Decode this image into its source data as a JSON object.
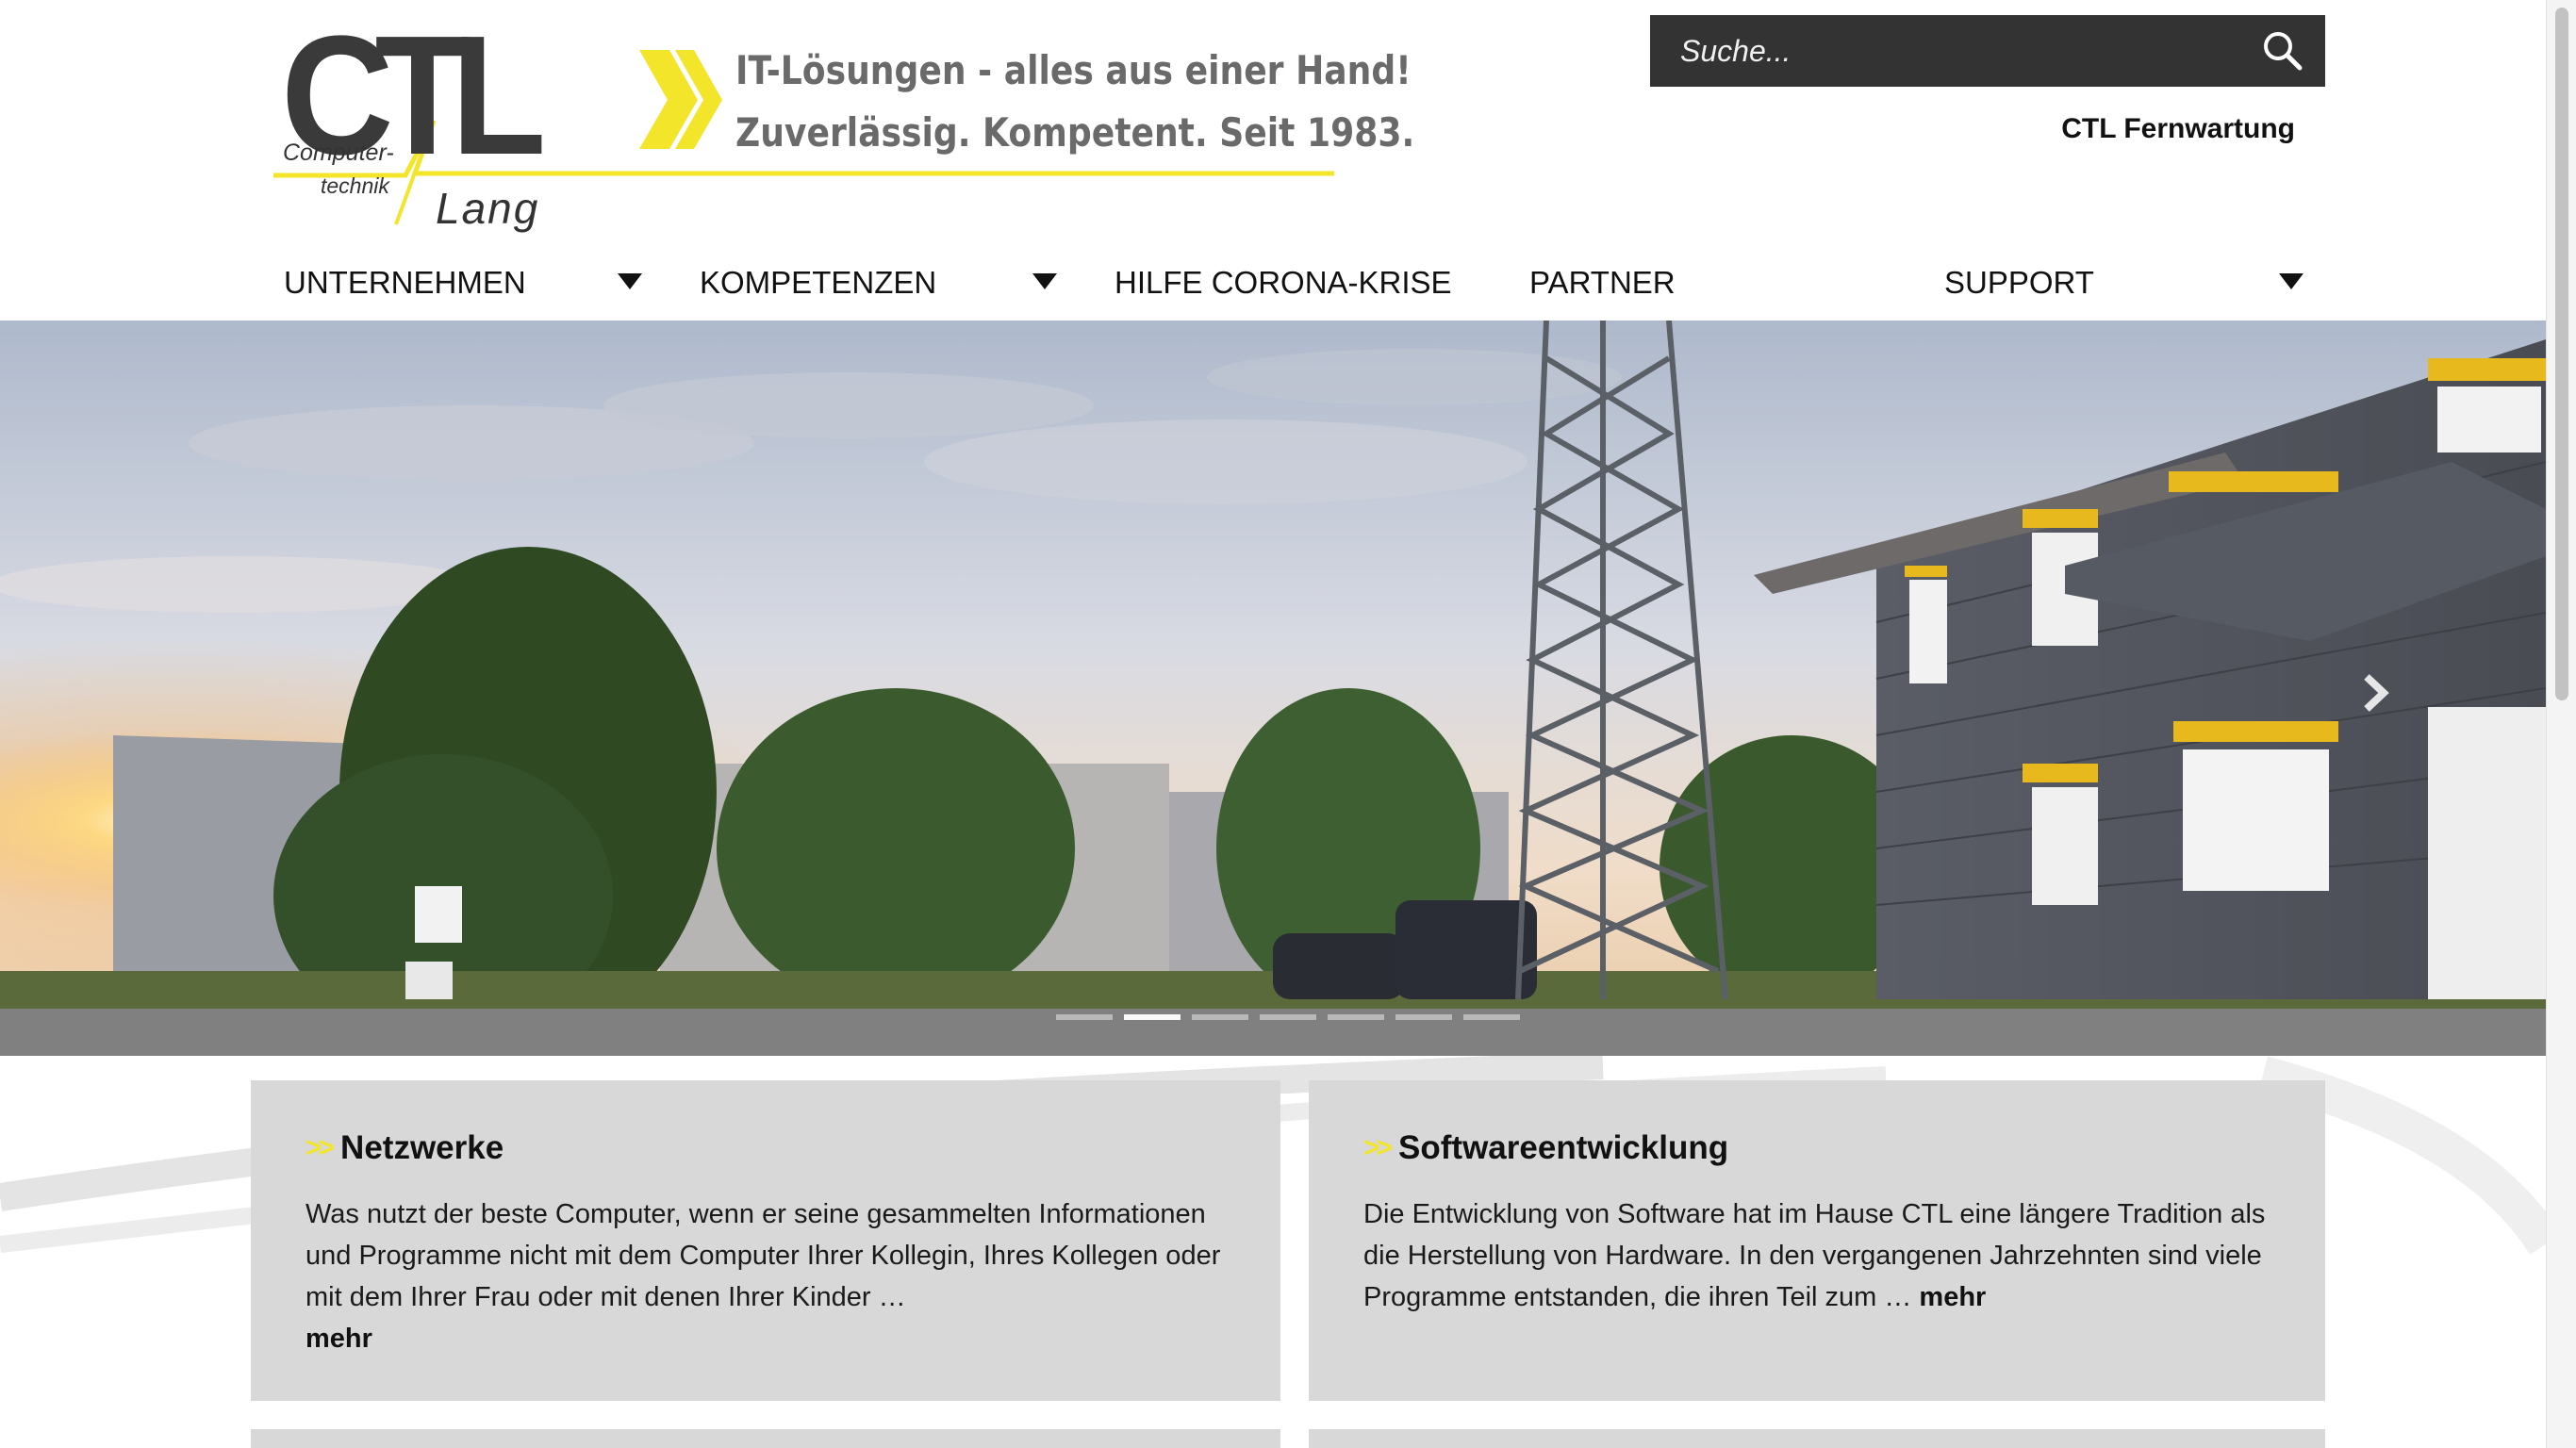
{
  "logo": {
    "letters": "CTL",
    "computer": "Computer-",
    "technik": "technik",
    "lang": "Lang",
    "slogan_line1": "IT-Lösungen - alles aus einer Hand!",
    "slogan_line2": "Zuverlässig. Kompetent. Seit 1983."
  },
  "search": {
    "placeholder": "Suche..."
  },
  "header_link": "CTL Fernwartung",
  "nav": {
    "items": [
      {
        "label": "UNTERNEHMEN",
        "has_dropdown": true
      },
      {
        "label": "KOMPETENZEN",
        "has_dropdown": true
      },
      {
        "label": "HILFE CORONA-KRISE",
        "has_dropdown": false
      },
      {
        "label": "PARTNER",
        "has_dropdown": false
      },
      {
        "label": "SUPPORT",
        "has_dropdown": true
      }
    ]
  },
  "slider": {
    "slide_count": 7,
    "active_index": 1
  },
  "cards": [
    {
      "title": "Netzwerke",
      "text": "Was nutzt der beste Computer, wenn er seine gesammelten Informationen und Programme nicht mit dem Computer Ihrer Kollegin, Ihres Kollegen oder mit dem Ihrer Frau oder mit denen Ihrer Kinder …",
      "more": "mehr"
    },
    {
      "title": "Softwareentwicklung",
      "text": "Die Entwicklung von Software hat im Hause CTL eine längere Tradition als die Herstellung von Hardware. In den vergangenen Jahrzehnten sind viele Programme entstanden, die ihren Teil zum …",
      "more": "mehr"
    }
  ],
  "colors": {
    "accent_yellow": "#f2e52a",
    "search_bg": "#333333",
    "card_bg": "#d8d8d8"
  }
}
